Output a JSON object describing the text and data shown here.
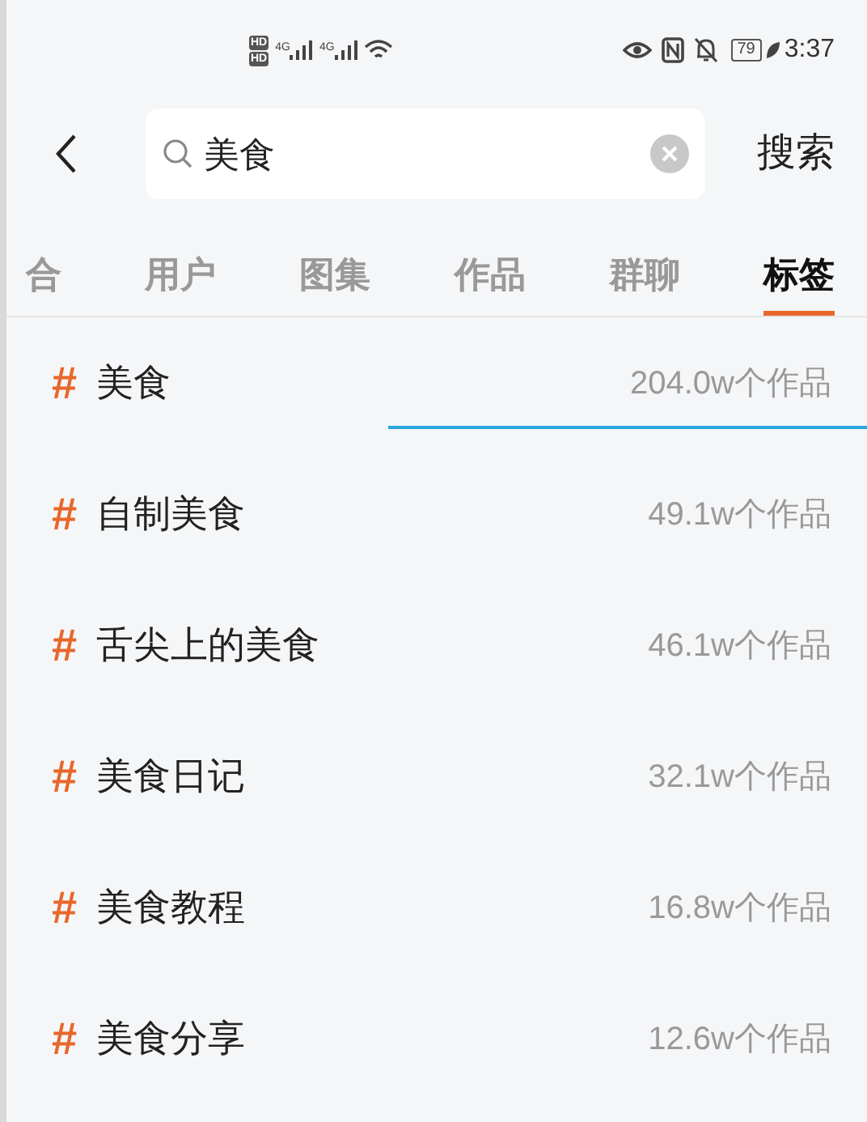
{
  "status_bar": {
    "sim_badges": [
      "HD",
      "HD"
    ],
    "network_labels": [
      "4G",
      "4G"
    ],
    "battery": "79",
    "time": "3:37"
  },
  "search": {
    "value": "美食",
    "submit": "搜索"
  },
  "tabs": [
    {
      "label": "合",
      "selected": false
    },
    {
      "label": "用户",
      "selected": false
    },
    {
      "label": "图集",
      "selected": false
    },
    {
      "label": "作品",
      "selected": false
    },
    {
      "label": "群聊",
      "selected": false
    },
    {
      "label": "标签",
      "selected": true
    }
  ],
  "tags": [
    {
      "hash": "#",
      "name": "美食",
      "count": "204.0w个作品"
    },
    {
      "hash": "#",
      "name": "自制美食",
      "count": "49.1w个作品"
    },
    {
      "hash": "#",
      "name": "舌尖上的美食",
      "count": "46.1w个作品"
    },
    {
      "hash": "#",
      "name": "美食日记",
      "count": "32.1w个作品"
    },
    {
      "hash": "#",
      "name": "美食教程",
      "count": "16.8w个作品"
    },
    {
      "hash": "#",
      "name": "美食分享",
      "count": "12.6w个作品"
    }
  ]
}
